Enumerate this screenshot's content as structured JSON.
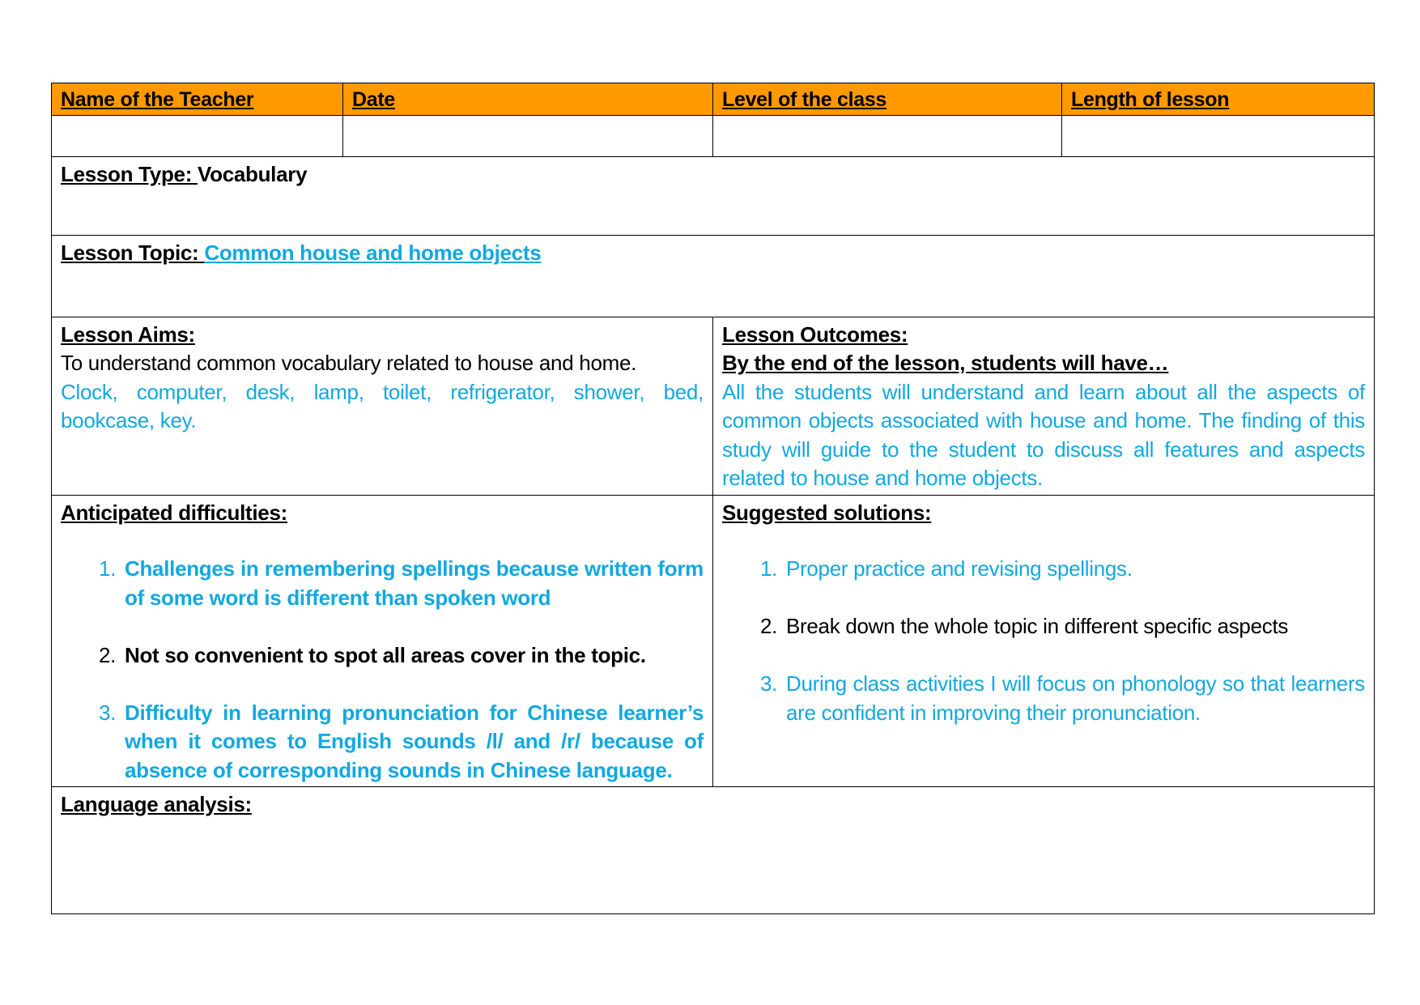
{
  "header": {
    "teacher_label": "Name of the Teacher",
    "date_label": "Date",
    "level_label": "Level of the class",
    "length_label": "Length of lesson"
  },
  "header_values": {
    "teacher": "",
    "date": "",
    "level": "",
    "length": ""
  },
  "lesson_type": {
    "label": "Lesson Type: ",
    "value": "Vocabulary"
  },
  "lesson_topic": {
    "label": "Lesson Topic: ",
    "value": "Common house and home objects "
  },
  "lesson_aims": {
    "label": "Lesson Aims:",
    "text": "To understand common vocabulary related to house and home.",
    "vocabulary": "Clock, computer, desk, lamp, toilet, refrigerator, shower, bed, bookcase, key."
  },
  "lesson_outcomes": {
    "label": "Lesson Outcomes: ",
    "subheading": "By the end of the lesson, students will have… ",
    "text": "All the students will understand and learn about all the aspects of common objects associated with house and home. The finding of this study will guide to the student to discuss all features and aspects related to house and home objects."
  },
  "anticipated_difficulties": {
    "label": "Anticipated difficulties: ",
    "items": [
      {
        "text": "Challenges in remembering spellings because written form of some word is different than spoken word",
        "color": "#11a8e0"
      },
      {
        "text": "Not so convenient to spot all areas cover in the topic.",
        "color": "#000000"
      },
      {
        "text": "Difficulty in learning pronunciation for Chinese learner’s when it comes to English sounds /l/ and /r/ because of absence of corresponding sounds in Chinese language.",
        "color": "#11a8e0"
      }
    ]
  },
  "suggested_solutions": {
    "label": "Suggested solutions:",
    "items": [
      {
        "text": "Proper practice and revising spellings.",
        "color": "#11a8e0"
      },
      {
        "text": "Break down the whole topic in different specific aspects",
        "color": "#000000"
      },
      {
        "text": "During class activities I will focus on phonology so that learners are confident in improving their pronunciation.",
        "color": "#11a8e0"
      }
    ]
  },
  "language_analysis": {
    "label": "Language analysis:",
    "value": ""
  },
  "colors": {
    "header_bg": "#ff9900",
    "accent_blue": "#11a8e0"
  }
}
